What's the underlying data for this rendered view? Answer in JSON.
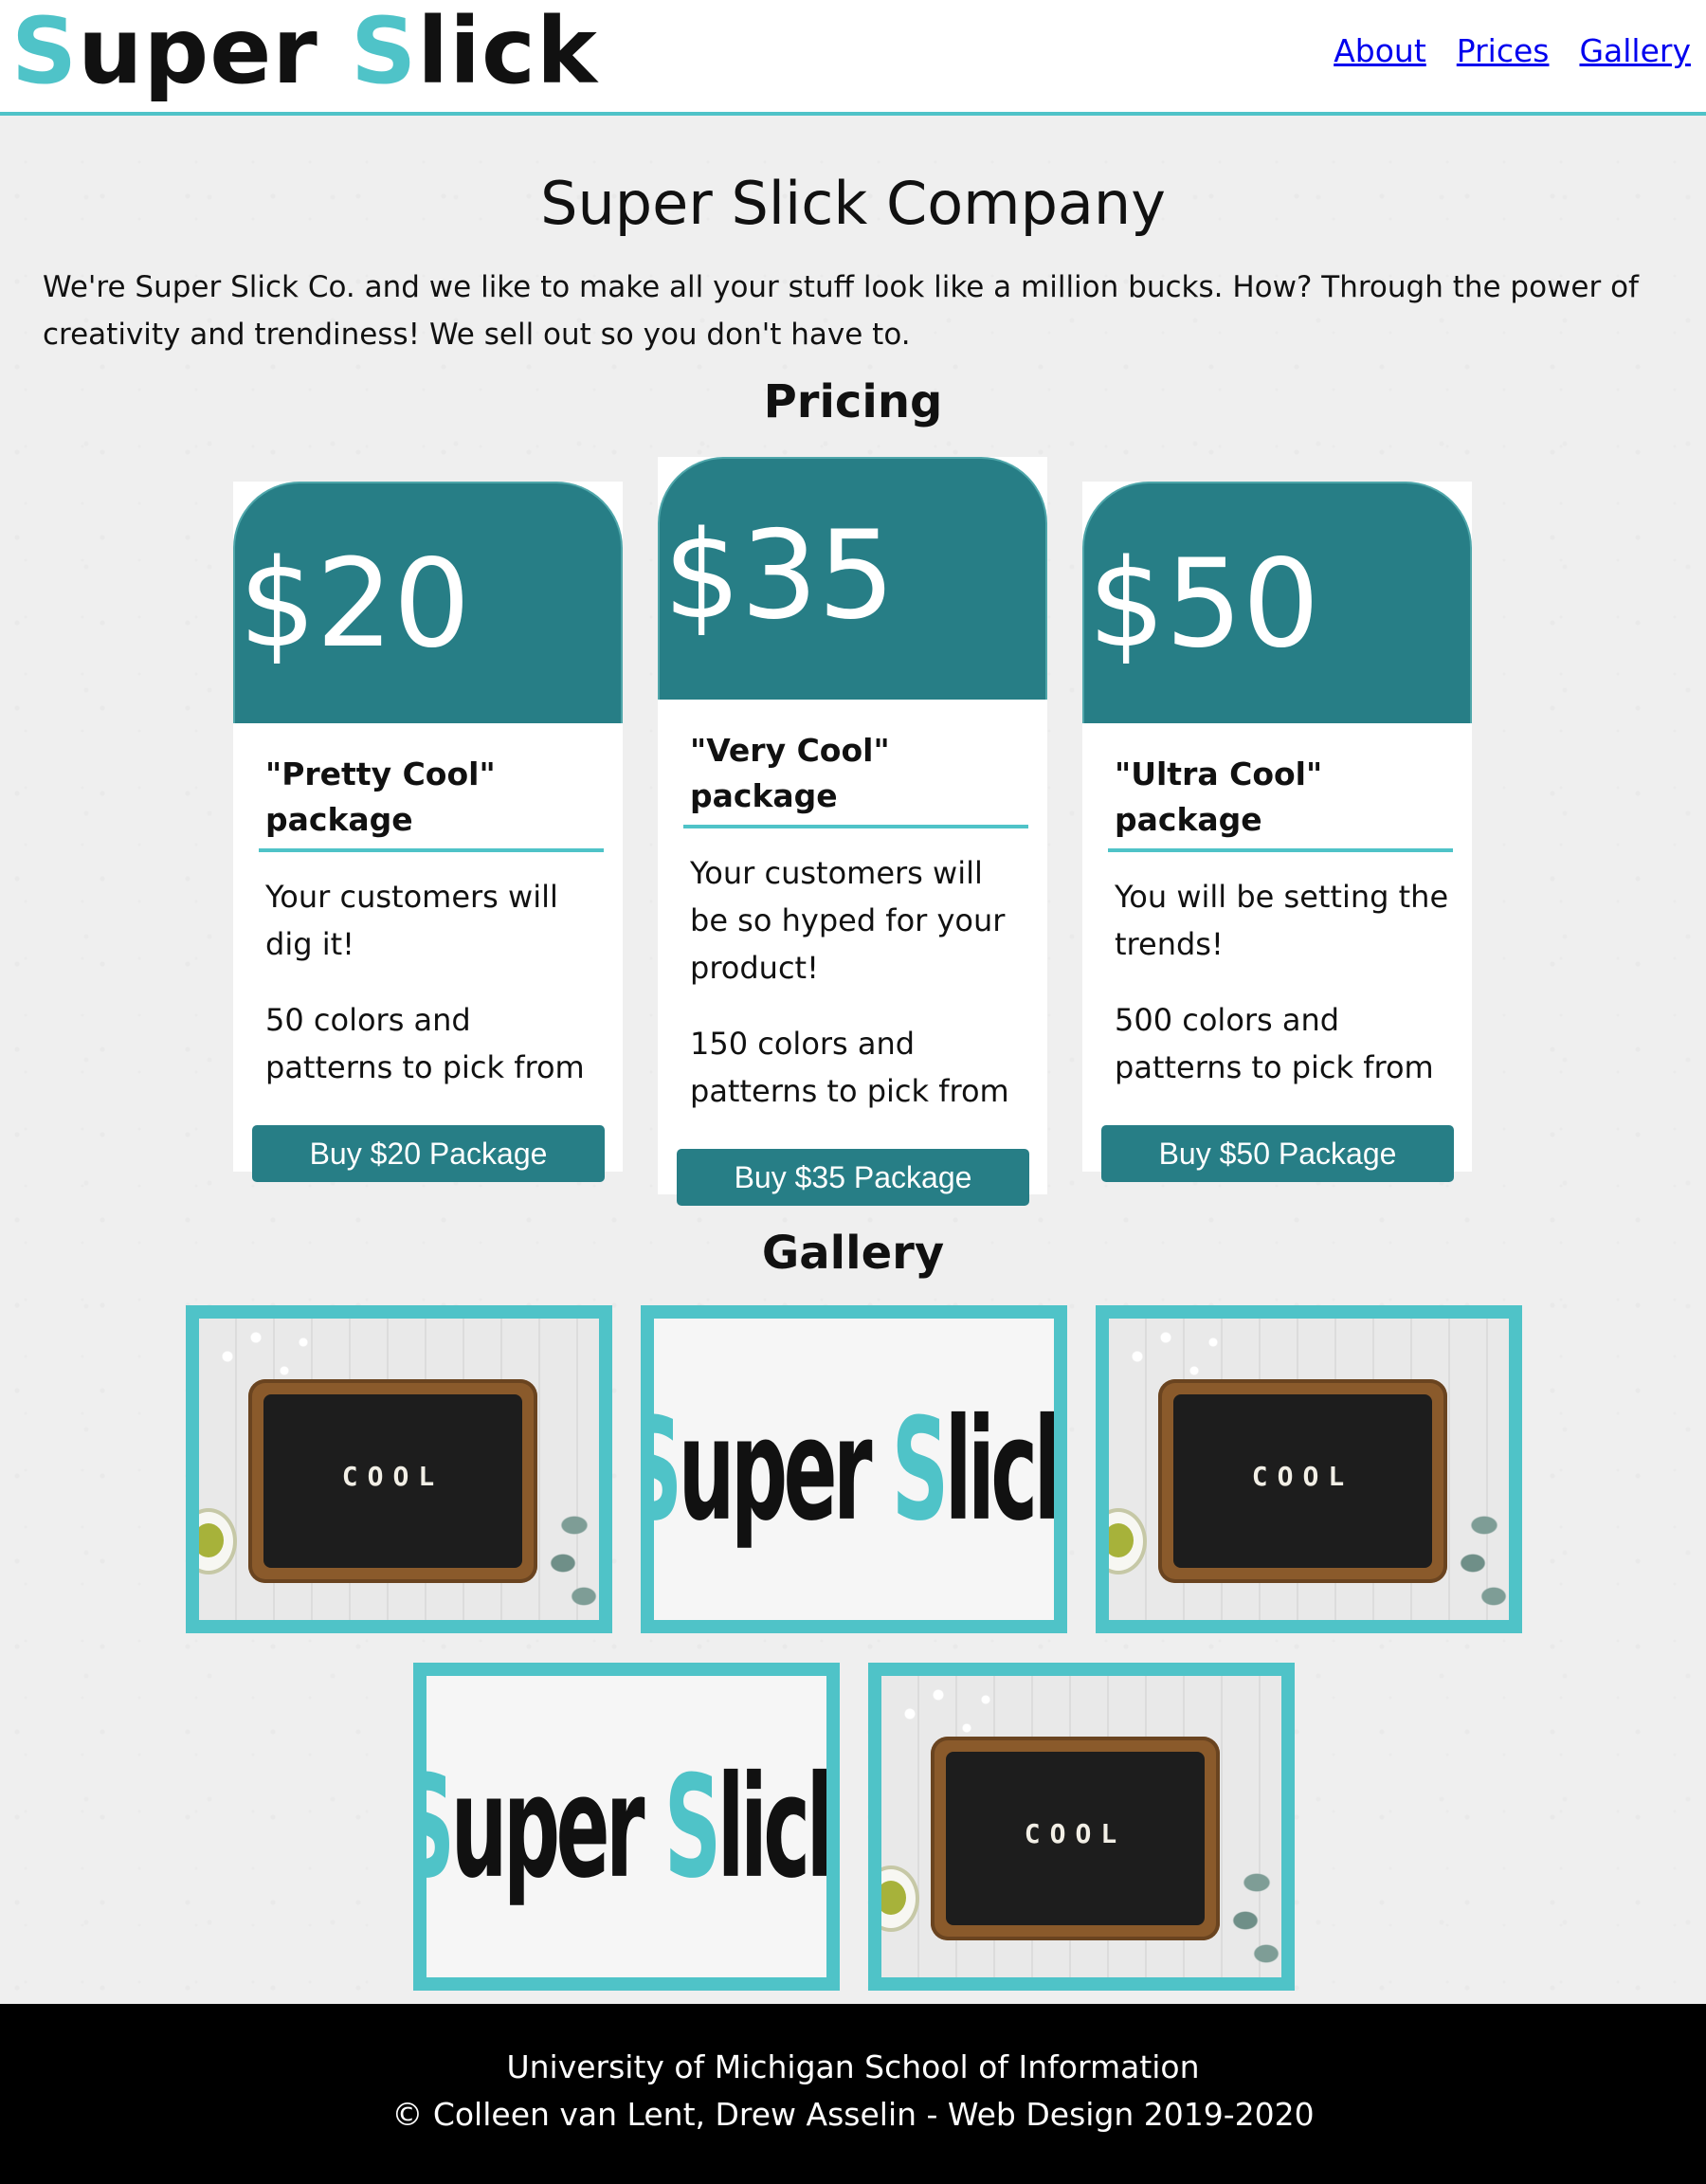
{
  "header": {
    "logo_part1": "S",
    "logo_part2": "uper ",
    "logo_part3": "S",
    "logo_part4": "lick",
    "nav": [
      "About",
      "Prices",
      "Gallery"
    ]
  },
  "main": {
    "title": "Super Slick Company",
    "intro": "We're Super Slick Co. and we like to make all your stuff look like a million bucks. How? Through the power of creativity and trendiness! We sell out so you don't have to.",
    "pricing_title": "Pricing",
    "gallery_title": "Gallery"
  },
  "cards": [
    {
      "price": "$20",
      "package": "\"Pretty Cool\" package",
      "description": "Your customers will dig it!",
      "features": "50 colors and patterns to pick from",
      "button": "Buy $20 Package"
    },
    {
      "price": "$35",
      "package": "\"Very Cool\" package",
      "description": "Your customers will be so hyped for your product!",
      "features": "150 colors and patterns to pick from",
      "button": "Buy $35 Package"
    },
    {
      "price": "$50",
      "package": "\"Ultra Cool\" package",
      "description": "You will be setting the trends!",
      "features": "500 colors and patterns to pick from",
      "button": "Buy $50 Package"
    }
  ],
  "gallery": {
    "board_word": "COOL",
    "logo_part1": "S",
    "logo_part2": "uper ",
    "logo_part3": "S",
    "logo_part4": "lick"
  },
  "footer": {
    "line1": "University of Michigan School of Information",
    "line2": "© Colleen van Lent, Drew Asselin - Web Design 2019-2020"
  },
  "colors": {
    "accent": "#4fc3c8",
    "card_header": "#277e86",
    "link": "#0000ee",
    "footer_bg": "#000000"
  }
}
